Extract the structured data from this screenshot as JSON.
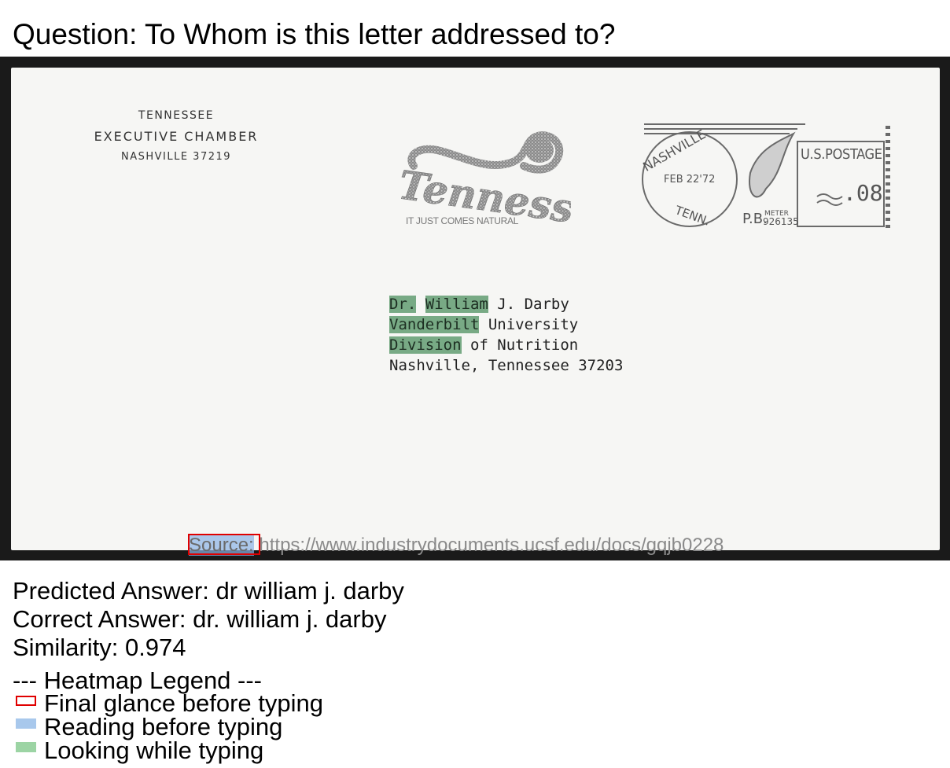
{
  "question": "Question: To Whom is this letter addressed to?",
  "envelope": {
    "sender": [
      "TENNESSEE",
      "EXECUTIVE CHAMBER",
      "NASHVILLE  37219"
    ],
    "logo_text": "Tennessee",
    "tagline": "IT JUST COMES NATURAL",
    "postmark": {
      "city": "NASHVILLE",
      "state": "TENN.",
      "date": "FEB 22'72",
      "postage_label": "U.S.POSTAGE",
      "amount": ".08",
      "meter_prefix": "P.B.",
      "meter_label": "METER",
      "meter_number": "926135"
    },
    "address": {
      "line1": {
        "hl1": "Dr.",
        "hl2": "William",
        "rest": " J. Darby"
      },
      "line2": {
        "hl": "Vanderbilt",
        "rest": " University"
      },
      "line3": {
        "hl": "Division",
        "rest": " of Nutrition"
      },
      "line4": "Nashville, Tennessee 37203"
    },
    "source_label": "Source:",
    "source_url": " https://www.industrydocuments.ucsf.edu/docs/gqjb0228"
  },
  "results": {
    "predicted": "Predicted Answer: dr william j. darby",
    "correct": "Correct Answer: dr. william j. darby",
    "similarity": "Similarity: 0.974"
  },
  "legend": {
    "title": "--- Heatmap Legend ---",
    "items": [
      "Final glance before typing",
      "Reading before typing",
      "Looking while typing"
    ]
  },
  "colors": {
    "final_glance": "#e00000",
    "reading": "#a8c8ec",
    "looking": "#9cd4a4"
  }
}
